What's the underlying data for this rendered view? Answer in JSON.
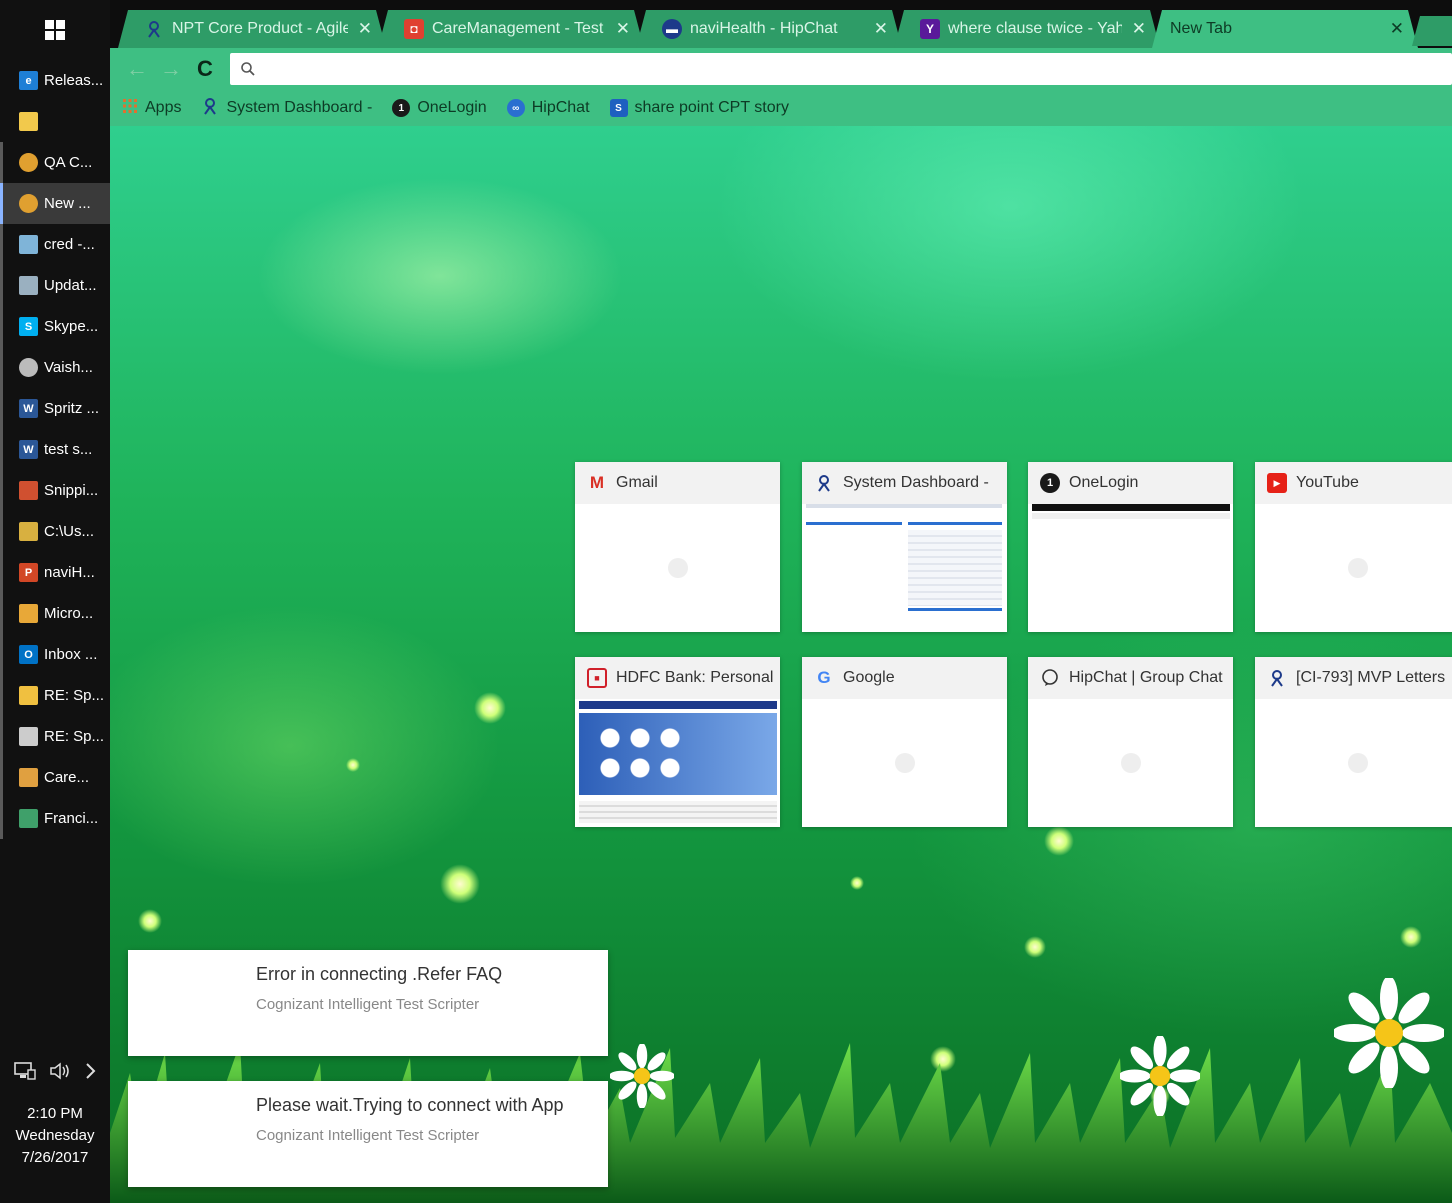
{
  "taskbar": {
    "items": [
      {
        "label": "Releas...",
        "icon": "edge-icon",
        "color": "#1e7fd6",
        "glyph": "e"
      },
      {
        "label": "",
        "icon": "file-explorer-icon",
        "color": "#f2c94c",
        "glyph": ""
      },
      {
        "label": "QA C...",
        "icon": "chrome-icon",
        "color": "#e0a030",
        "glyph": ""
      },
      {
        "label": "New ...",
        "icon": "chrome-icon",
        "color": "#e0a030",
        "glyph": ""
      },
      {
        "label": "cred -...",
        "icon": "notepad-icon",
        "color": "#7fb4d8",
        "glyph": ""
      },
      {
        "label": "Updat...",
        "icon": "notepad-icon",
        "color": "#9ab0c0",
        "glyph": ""
      },
      {
        "label": "Skype...",
        "icon": "skype-icon",
        "color": "#00aff0",
        "glyph": "S"
      },
      {
        "label": "Vaish...",
        "icon": "disc-icon",
        "color": "#bbbbbb",
        "glyph": ""
      },
      {
        "label": "Spritz ...",
        "icon": "word-icon",
        "color": "#2b5797",
        "glyph": "W"
      },
      {
        "label": "test s...",
        "icon": "word-icon",
        "color": "#2b5797",
        "glyph": "W"
      },
      {
        "label": "Snippi...",
        "icon": "snipping-tool-icon",
        "color": "#d05030",
        "glyph": ""
      },
      {
        "label": "C:\\Us...",
        "icon": "folder-icon",
        "color": "#d8b040",
        "glyph": ""
      },
      {
        "label": "naviH...",
        "icon": "powerpoint-icon",
        "color": "#d24726",
        "glyph": "P"
      },
      {
        "label": "Micro...",
        "icon": "microsoft-app-icon",
        "color": "#e8a838",
        "glyph": ""
      },
      {
        "label": "Inbox ...",
        "icon": "outlook-icon",
        "color": "#0072c6",
        "glyph": "O"
      },
      {
        "label": "RE: Sp...",
        "icon": "mail-icon",
        "color": "#f0c040",
        "glyph": ""
      },
      {
        "label": "RE: Sp...",
        "icon": "mail-icon",
        "color": "#cccccc",
        "glyph": ""
      },
      {
        "label": "Care...",
        "icon": "image-icon",
        "color": "#e0a040",
        "glyph": ""
      },
      {
        "label": "Franci...",
        "icon": "spreadsheet-icon",
        "color": "#3fa06a",
        "glyph": ""
      }
    ],
    "clock": {
      "time": "2:10 PM",
      "day": "Wednesday",
      "date": "7/26/2017"
    }
  },
  "tabs": [
    {
      "title": "NPT Core Product - Agile",
      "icon": "jira-icon",
      "color": "#1d3a8a"
    },
    {
      "title": "CareManagement - Test",
      "icon": "caremanagement-icon",
      "color": "#e04030"
    },
    {
      "title": "naviHealth - HipChat",
      "icon": "hipchat-icon",
      "color": "#1d3a8a"
    },
    {
      "title": "where clause twice - Yahoo",
      "icon": "yahoo-icon",
      "color": "#5a1a9a"
    },
    {
      "title": "New Tab",
      "icon": "",
      "color": ""
    }
  ],
  "omnibox": {
    "value": "",
    "placeholder": ""
  },
  "bookmarks": [
    {
      "label": "Apps",
      "icon": "apps-grid-icon",
      "color": "#e07030"
    },
    {
      "label": "System Dashboard -",
      "icon": "jira-icon",
      "color": "#1d3a8a"
    },
    {
      "label": "OneLogin",
      "icon": "onelogin-icon",
      "color": "#1a1a1a"
    },
    {
      "label": "HipChat",
      "icon": "hipchat-icon",
      "color": "#2a6fd0"
    },
    {
      "label": "share point CPT story",
      "icon": "sharepoint-icon",
      "color": "#1e60c0"
    }
  ],
  "tiles": [
    {
      "title": "Gmail",
      "icon": "gmail-icon",
      "glyph": "M",
      "color": "#d93025"
    },
    {
      "title": "System Dashboard -",
      "icon": "jira-icon",
      "glyph": "",
      "color": "#1d3a8a"
    },
    {
      "title": "OneLogin",
      "icon": "onelogin-icon",
      "glyph": "1",
      "color": "#1a1a1a"
    },
    {
      "title": "YouTube",
      "icon": "youtube-icon",
      "glyph": "▶",
      "color": "#e62117"
    },
    {
      "title": "HDFC Bank: Personal",
      "icon": "hdfc-icon",
      "glyph": "■",
      "color": "#d0202a"
    },
    {
      "title": "Google",
      "icon": "google-icon",
      "glyph": "G",
      "color": "#4285f4"
    },
    {
      "title": "HipChat | Group Chat",
      "icon": "hipchat-icon",
      "glyph": "",
      "color": "#333333"
    },
    {
      "title": "[CI-793] MVP Letters",
      "icon": "jira-icon",
      "glyph": "",
      "color": "#1d3a8a"
    }
  ],
  "notifications": [
    {
      "title": "Error in connecting .Refer FAQ",
      "source": "Cognizant Intelligent Test Scripter"
    },
    {
      "title": "Please wait.Trying to connect with App",
      "source": "Cognizant Intelligent Test Scripter"
    }
  ],
  "colors": {
    "chrome_theme": "#3ebf83",
    "tab_inactive": "#2e9c67",
    "taskbar": "#111111"
  }
}
